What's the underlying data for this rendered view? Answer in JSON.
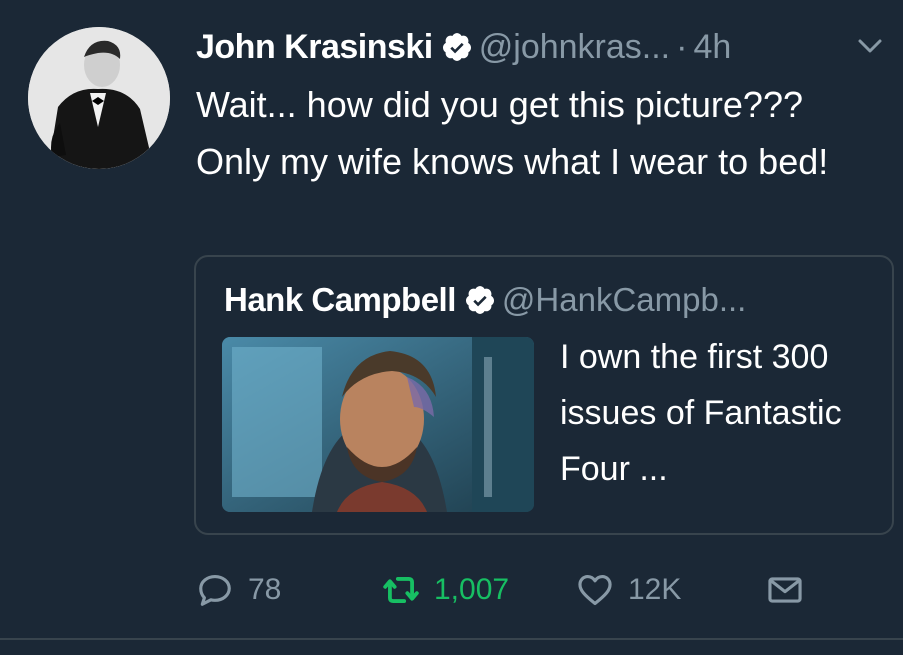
{
  "tweet": {
    "author_name": "John Krasinski",
    "handle": "@johnkras...",
    "separator": "·",
    "time": "4h",
    "text": "Wait... how did you get this picture??? Only my wife knows what I wear to bed!"
  },
  "quoted_tweet": {
    "author_name": "Hank Campbell",
    "handle": "@HankCampb...",
    "text": "I own the first 300 issues of Fantastic Four ..."
  },
  "actions": {
    "replies": "78",
    "retweets": "1,007",
    "likes": "12K"
  },
  "colors": {
    "background": "#1b2836",
    "secondary_text": "#8899a6",
    "verified_badge": "#ffffff",
    "retweet_green": "#17bf63",
    "border": "#38444d"
  },
  "icons": {
    "verified": "verified-badge-icon",
    "caret": "chevron-down-icon",
    "reply": "reply-icon",
    "retweet": "retweet-icon",
    "like": "heart-icon",
    "dm": "envelope-icon"
  }
}
